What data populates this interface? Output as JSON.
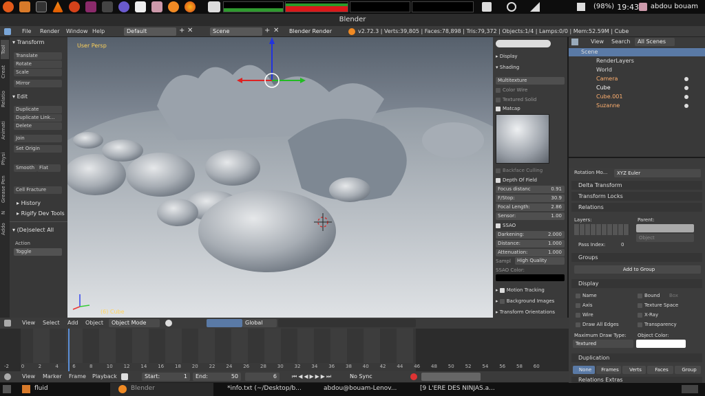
{
  "window": {
    "title": "Blender"
  },
  "top_panel": {
    "battery": "(98%)",
    "clock": "19:43",
    "user": "abdou bouam"
  },
  "info_header": {
    "menus": [
      "File",
      "Render",
      "Window",
      "Help"
    ],
    "screen_layout": "Default",
    "scene": "Scene",
    "render_engine": "Blender Render",
    "stats": "v2.72.3 | Verts:39,805 | Faces:78,898 | Tris:79,372 | Objects:1/4 | Lamps:0/0 | Mem:52.59M | Cube"
  },
  "left_tabs": [
    "Tool",
    "Creat",
    "Relatio",
    "Animati",
    "Physi",
    "Grease Pen",
    "N",
    "Addo"
  ],
  "tool_shelf": {
    "transform_header": "Transform",
    "transform_buttons": [
      "Translate",
      "Rotate",
      "Scale",
      "Mirror"
    ],
    "edit_header": "Edit",
    "edit_buttons": [
      "Duplicate",
      "Duplicate Link...",
      "Delete",
      "Join",
      "Set Origin"
    ],
    "shading_buttons": [
      "Smooth",
      "Flat"
    ],
    "cell_fracture": "Cell Fracture",
    "history": "History",
    "rigify": "Rigify Dev Tools",
    "operator_header": "(De)select All",
    "action_label": "Action",
    "action_value": "Toggle"
  },
  "viewport": {
    "view_label": "User Persp",
    "object_label": "(6) Cube"
  },
  "n_panel": {
    "display": "Display",
    "shading": "Shading",
    "shading_mode": "Multitexture",
    "color_wire": "Color Wire",
    "textured_solid": "Textured Solid",
    "matcap": "Matcap",
    "backface_culling": "Backface Culling",
    "depth_of_field": "Depth Of Field",
    "dof_rows": [
      {
        "label": "Focus distanc",
        "value": "0.91"
      },
      {
        "label": "F/Stop:",
        "value": "30.9"
      },
      {
        "label": "Focal Length:",
        "value": "2.86"
      },
      {
        "label": "Sensor:",
        "value": "1.00"
      }
    ],
    "ssao": "SSAO",
    "ssao_rows": [
      {
        "label": "Darkening:",
        "value": "2.000"
      },
      {
        "label": "Distance:",
        "value": "1.000"
      },
      {
        "label": "Attenuation:",
        "value": "1.000"
      }
    ],
    "samples_label": "Sampl",
    "samples_value": "High Quality",
    "ssao_color_label": "SSAO Color:",
    "motion_tracking": "Motion Tracking",
    "background_images": "Background Images",
    "transform_orientations": "Transform Orientations"
  },
  "outliner": {
    "menus": [
      "View",
      "Search"
    ],
    "filter": "All Scenes",
    "items": [
      {
        "name": "Scene",
        "indent": 0
      },
      {
        "name": "RenderLayers",
        "indent": 1
      },
      {
        "name": "World",
        "indent": 1
      },
      {
        "name": "Camera",
        "indent": 1
      },
      {
        "name": "Cube",
        "indent": 1
      },
      {
        "name": "Cube.001",
        "indent": 1
      },
      {
        "name": "Suzanne",
        "indent": 1
      }
    ]
  },
  "properties": {
    "rotation_mode_label": "Rotation Mo...",
    "rotation_mode_value": "XYZ Euler",
    "delta_transform": "Delta Transform",
    "transform_locks": "Transform Locks",
    "relations": "Relations",
    "layers_label": "Layers:",
    "parent_label": "Parent:",
    "parent_type": "Object",
    "pass_index_label": "Pass Index:",
    "pass_index_value": "0",
    "groups": "Groups",
    "add_to_group": "Add to Group",
    "display": "Display",
    "display_left": [
      "Name",
      "Axis",
      "Wire",
      "Draw All Edges"
    ],
    "display_right": [
      "Bound",
      "Texture Space",
      "X-Ray",
      "Transparency"
    ],
    "bound_type": "Box",
    "max_draw_type_label": "Maximum Draw Type:",
    "max_draw_type_value": "Textured",
    "object_color_label": "Object Color:",
    "duplication": "Duplication",
    "dup_options": [
      "None",
      "Frames",
      "Verts",
      "Faces",
      "Group"
    ],
    "relations_extras": "Relations Extras"
  },
  "view3d_header": {
    "menus": [
      "View",
      "Select",
      "Add",
      "Object"
    ],
    "mode": "Object Mode",
    "orientation": "Global"
  },
  "timeline": {
    "ticks": [
      "-2",
      "0",
      "2",
      "4",
      "6",
      "8",
      "10",
      "12",
      "14",
      "16",
      "18",
      "20",
      "22",
      "24",
      "26",
      "28",
      "30",
      "32",
      "34",
      "36",
      "38",
      "40",
      "42",
      "44",
      "46",
      "48",
      "50",
      "52",
      "54",
      "56",
      "58",
      "60"
    ],
    "menus": [
      "View",
      "Marker",
      "Frame",
      "Playback"
    ],
    "start_label": "Start:",
    "start_value": "1",
    "end_label": "End:",
    "end_value": "50",
    "current_frame": "6",
    "sync": "No Sync"
  },
  "taskbar": {
    "items": [
      "fluid",
      "Blender",
      "*info.txt (~/Desktop/b...",
      "abdou@bouam-Lenov...",
      "[9 L'ERE DES NINJAS.a..."
    ]
  }
}
